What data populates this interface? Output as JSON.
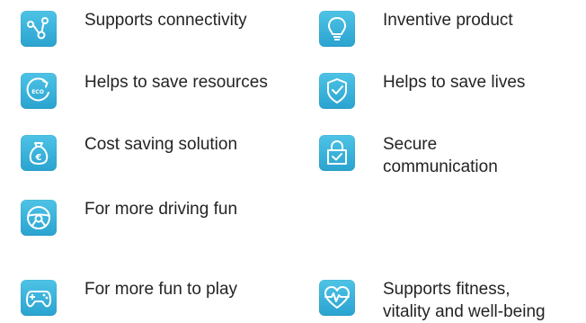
{
  "features": [
    {
      "label": "Supports connectivity",
      "icon": "connectivity-icon"
    },
    {
      "label": "Inventive product",
      "icon": "lightbulb-icon"
    },
    {
      "label": "Helps to save resources",
      "icon": "eco-icon"
    },
    {
      "label": "Helps to save lives",
      "icon": "shield-check-icon"
    },
    {
      "label": "Cost saving solution",
      "icon": "money-bag-icon"
    },
    {
      "label_line1": "Secure",
      "label_line2": "communication",
      "icon": "lock-icon"
    },
    {
      "label": "For more driving fun",
      "icon": "steering-wheel-icon"
    },
    {
      "label": "For more fun to play",
      "icon": "gamepad-icon"
    },
    {
      "label_line1": "Supports fitness,",
      "label_line2": "vitality and well-being",
      "icon": "heart-pulse-icon"
    }
  ],
  "colors": {
    "icon_background": "#35b3dd",
    "icon_glyph": "#ffffff",
    "text": "#242424"
  }
}
